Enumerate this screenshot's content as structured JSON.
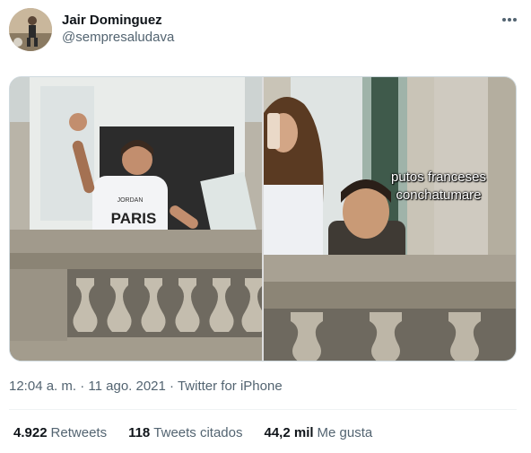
{
  "author": {
    "display_name": "Jair Dominguez",
    "handle": "@sempresaludava"
  },
  "media": {
    "overlay_caption": "putos franceses conchatumare",
    "shirt_text_small": "JORDAN",
    "shirt_text": "PARIS"
  },
  "meta": {
    "time": "12:04 a. m.",
    "sep1": " · ",
    "date": "11 ago. 2021",
    "sep2": " · ",
    "source": "Twitter for iPhone"
  },
  "stats": {
    "retweets_count": "4.922",
    "retweets_label": "Retweets",
    "quotes_count": "118",
    "quotes_label": "Tweets citados",
    "likes_count": "44,2 mil",
    "likes_label": "Me gusta"
  },
  "icons": {
    "more": "more-dots-icon"
  },
  "colors": {
    "primary_text": "#0f1419",
    "secondary_text": "#536471",
    "divider": "#eff3f4",
    "border": "#cfd9de"
  }
}
